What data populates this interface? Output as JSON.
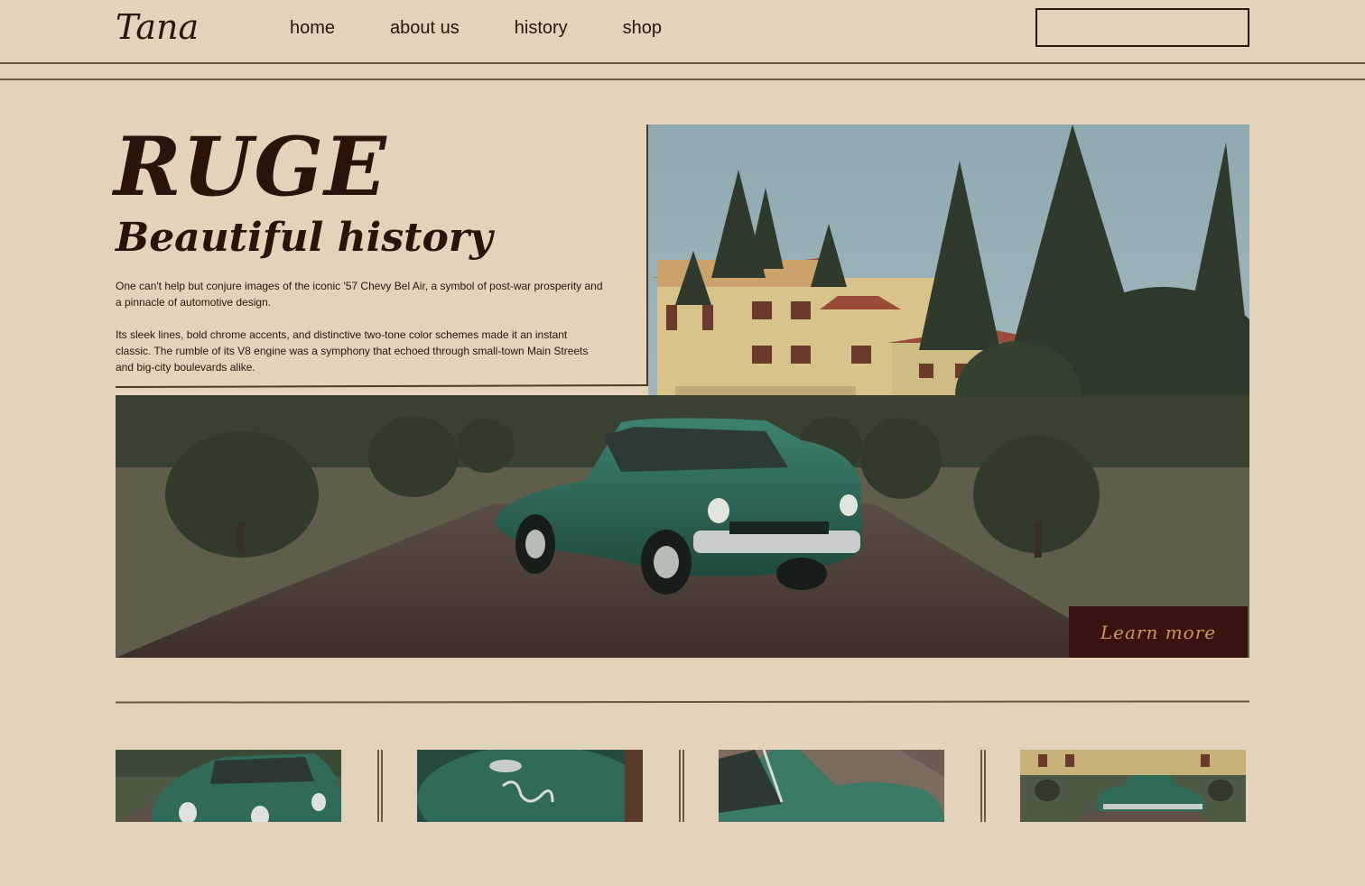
{
  "header": {
    "logo": "Tana",
    "nav": [
      "home",
      "about us",
      "history",
      "shop"
    ],
    "search_placeholder": ""
  },
  "hero": {
    "title": "RUGE",
    "subtitle": "Beautiful history",
    "paragraphs": [
      "One can't help but conjure images of the iconic '57 Chevy Bel Air, a symbol of post-war prosperity and a pinnacle of automotive design.",
      "Its sleek lines, bold chrome accents, and distinctive two-tone color schemes made it an instant classic. The rumble of its V8 engine was a symphony that echoed through small-town Main Streets and big-city boulevards alike."
    ],
    "cta_label": "Learn more",
    "photo_icon": "vintage-green-car-mansion-photo"
  },
  "thumbnails": [
    {
      "icon": "car-front-thumbnail"
    },
    {
      "icon": "car-emblem-thumbnail"
    },
    {
      "icon": "car-side-thumbnail"
    },
    {
      "icon": "car-mansion-thumbnail"
    }
  ],
  "colors": {
    "background": "#e3d3bb",
    "text": "#2b130c",
    "accent": "#3a1310",
    "accent_text": "#c9955c",
    "car": "#2f6b58"
  }
}
